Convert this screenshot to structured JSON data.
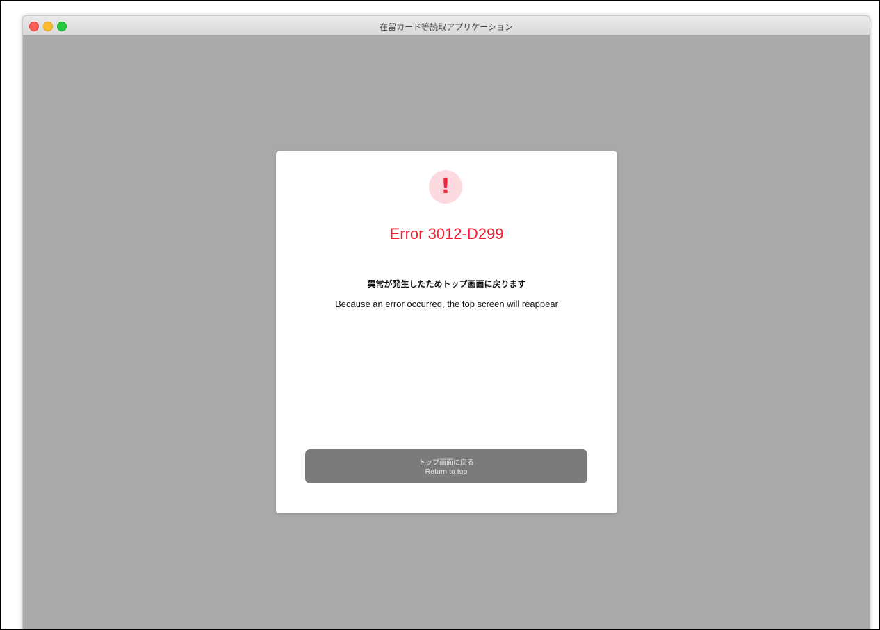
{
  "window": {
    "title": "在留カード等読取アプリケーション",
    "controls": {
      "close_color": "#fe5f57",
      "minimize_color": "#febc2e",
      "maximize_color": "#28c840"
    }
  },
  "dialog": {
    "icon": {
      "name": "exclamation-icon",
      "glyph": "!",
      "color": "#f0263c",
      "background": "#fbd9df"
    },
    "error_code": "Error 3012-D299",
    "message_ja": "異常が発生したためトップ画面に戻ります",
    "message_en": "Because an error occurred, the top screen will reappear",
    "button": {
      "label_ja": "トップ画面に戻る",
      "label_en": "Return to top"
    }
  },
  "colors": {
    "error_red": "#f01d33",
    "backdrop_gray": "#a9a9a9",
    "button_gray": "#7b7b7b"
  }
}
